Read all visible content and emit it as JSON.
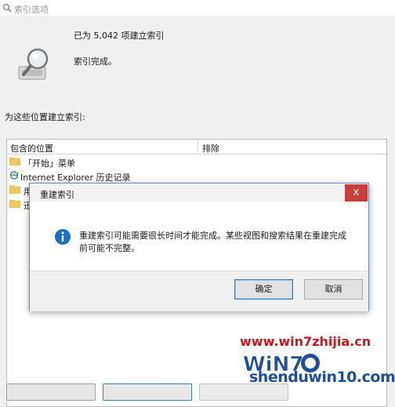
{
  "window": {
    "title": "索引选项"
  },
  "status": {
    "count_text": "已为 5,042 项建立索引",
    "complete_text": "索引完成。",
    "icon": "magnifier-index-icon"
  },
  "locations": {
    "label": "为这些位置建立索引:",
    "columns": [
      "包含的位置",
      "排除"
    ],
    "rows": [
      {
        "icon": "folder-icon",
        "label": "「开始」菜单"
      },
      {
        "icon": "ie-icon",
        "label": "Internet Explorer 历史记录"
      },
      {
        "icon": "folder-icon",
        "label": "用"
      },
      {
        "icon": "folder-icon",
        "label": "迅"
      }
    ]
  },
  "dialog": {
    "title": "重建索引",
    "close_glyph": "x",
    "message_line1": "重建索引可能需要很长时间才能完成。某些视图和搜索结果在重建完成",
    "message_line2": "前可能不完整。",
    "ok_label": "确定",
    "cancel_label": "取消",
    "info_icon": "info-icon"
  },
  "watermark": {
    "url": "www.win7zhijia.cn",
    "domain": "shenduwin10.com",
    "logo_text": "WiN7"
  },
  "colors": {
    "close_red": "#c8403a",
    "info_blue": "#1f6fbf",
    "watermark_red": "#d3141b",
    "watermark_blue": "#1d4f9a"
  }
}
